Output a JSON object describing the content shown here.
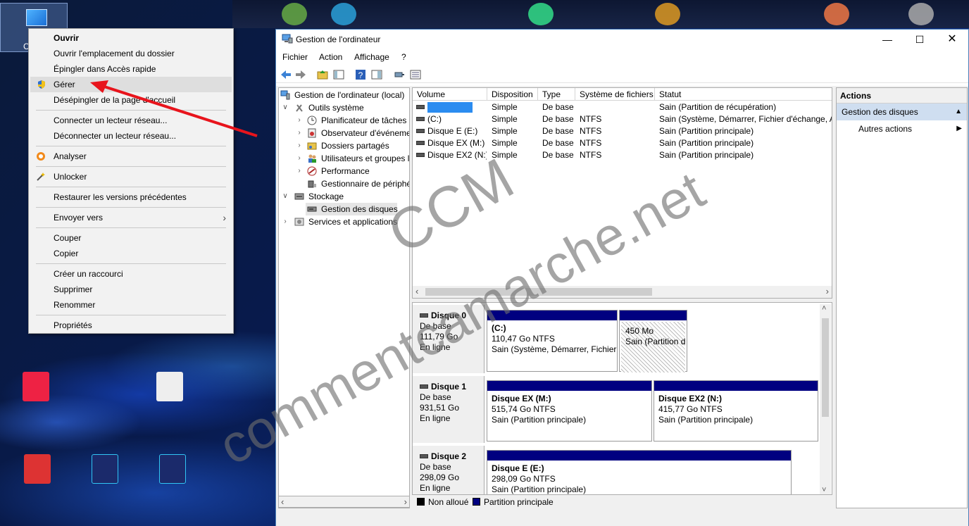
{
  "context_menu": {
    "items": [
      {
        "label": "Ouvrir",
        "bold": true
      },
      {
        "label": "Ouvrir l'emplacement du dossier"
      },
      {
        "label": "Épingler dans Accès rapide"
      },
      {
        "label": "Gérer",
        "icon": "shield-icon"
      },
      {
        "label": "Désépingler de la page d'accueil"
      },
      {
        "label": "Connecter un lecteur réseau..."
      },
      {
        "label": "Déconnecter un lecteur réseau..."
      },
      {
        "label": "Analyser",
        "icon": "avast-icon"
      },
      {
        "label": "Unlocker",
        "icon": "wand-icon"
      },
      {
        "label": "Restaurer les versions précédentes"
      },
      {
        "label": "Envoyer vers"
      },
      {
        "label": "Couper"
      },
      {
        "label": "Copier"
      },
      {
        "label": "Créer un raccourci"
      },
      {
        "label": "Supprimer"
      },
      {
        "label": "Renommer"
      },
      {
        "label": "Propriétés"
      }
    ]
  },
  "desktop": {
    "this_pc_label": "C"
  },
  "window": {
    "title": "Gestion de l'ordinateur",
    "menu": [
      "Fichier",
      "Action",
      "Affichage",
      "?"
    ]
  },
  "tree": {
    "root": "Gestion de l'ordinateur (local)",
    "system_tools": "Outils système",
    "task_scheduler": "Planificateur de tâches",
    "event_viewer": "Observateur d'événeme",
    "shared_folders": "Dossiers partagés",
    "users_groups": "Utilisateurs et groupes l",
    "performance": "Performance",
    "device_manager": "Gestionnaire de périphé",
    "storage": "Stockage",
    "disk_management": "Gestion des disques",
    "services_apps": "Services et applications"
  },
  "volumes": {
    "headers": [
      "Volume",
      "Disposition",
      "Type",
      "Système de fichiers",
      "Statut"
    ],
    "rows": [
      {
        "volume": "",
        "layout": "Simple",
        "type": "De base",
        "fs": "",
        "status": "Sain (Partition de récupération)"
      },
      {
        "volume": "(C:)",
        "layout": "Simple",
        "type": "De base",
        "fs": "NTFS",
        "status": "Sain (Système, Démarrer, Fichier d'échange, Ac"
      },
      {
        "volume": "Disque E (E:)",
        "layout": "Simple",
        "type": "De base",
        "fs": "NTFS",
        "status": "Sain (Partition principale)"
      },
      {
        "volume": "Disque EX (M:)",
        "layout": "Simple",
        "type": "De base",
        "fs": "NTFS",
        "status": "Sain (Partition principale)"
      },
      {
        "volume": "Disque EX2 (N:)",
        "layout": "Simple",
        "type": "De base",
        "fs": "NTFS",
        "status": "Sain (Partition principale)"
      }
    ]
  },
  "disks": [
    {
      "name": "Disque 0",
      "kind": "De base",
      "size": "111,79 Go",
      "state": "En ligne",
      "partitions": [
        {
          "title": "(C:)",
          "size": "110,47 Go NTFS",
          "status": "Sain (Système, Démarrer, Fichier"
        },
        {
          "title": "",
          "size": "450 Mo",
          "status": "Sain (Partition d"
        }
      ]
    },
    {
      "name": "Disque 1",
      "kind": "De base",
      "size": "931,51 Go",
      "state": "En ligne",
      "partitions": [
        {
          "title": "Disque EX  (M:)",
          "size": "515,74 Go NTFS",
          "status": "Sain (Partition principale)"
        },
        {
          "title": "Disque EX2  (N:)",
          "size": "415,77 Go NTFS",
          "status": "Sain (Partition principale)"
        }
      ]
    },
    {
      "name": "Disque 2",
      "kind": "De base",
      "size": "298,09 Go",
      "state": "En ligne",
      "partitions": [
        {
          "title": "Disque E  (E:)",
          "size": "298,09 Go NTFS",
          "status": "Sain (Partition principale)"
        }
      ]
    }
  ],
  "legend": {
    "unallocated": "Non alloué",
    "primary": "Partition principale"
  },
  "actions": {
    "title": "Actions",
    "section": "Gestion des disques",
    "more": "Autres actions"
  },
  "watermark": {
    "line1": "CCM",
    "line2": "commentcamarche.net"
  },
  "colors": {
    "primary_partition": "#000080",
    "annotation_arrow": "#e8141c",
    "selection": "#cfdef0"
  }
}
